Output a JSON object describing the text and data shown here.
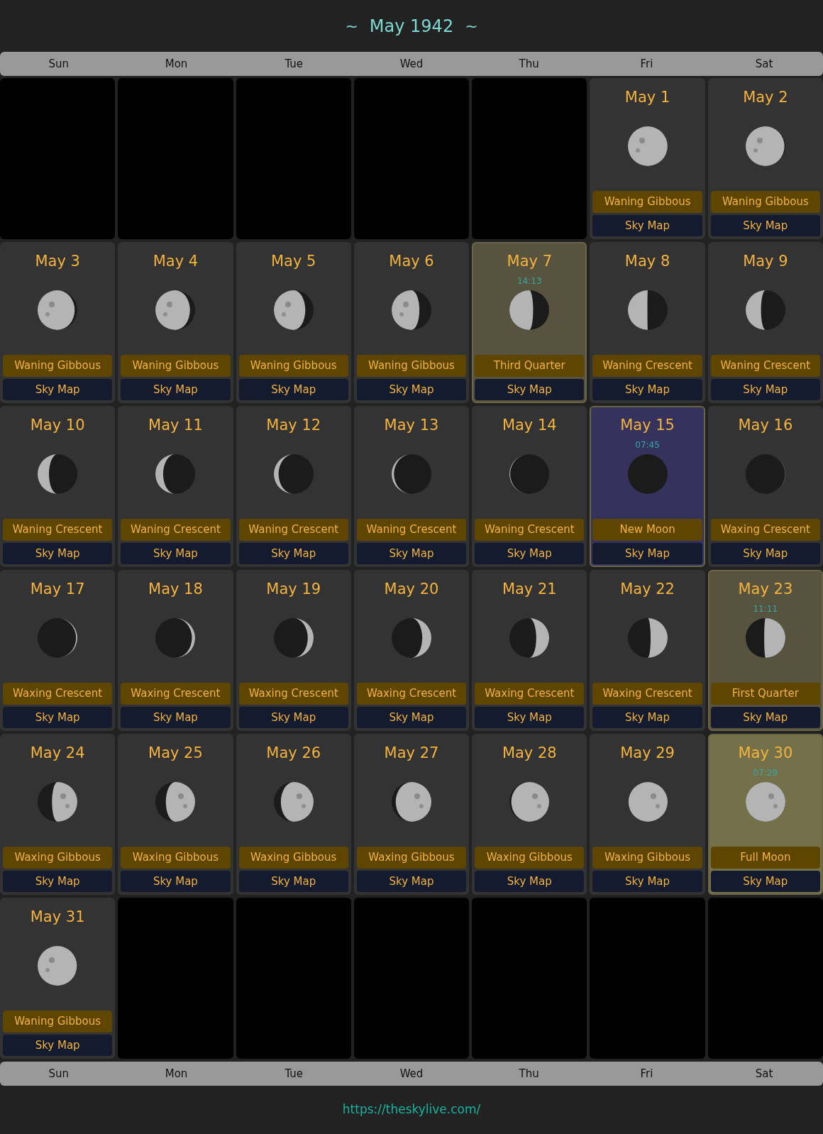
{
  "title": {
    "left": "~",
    "text": "May 1942",
    "right": "~"
  },
  "weekdays_top": [
    "Sun",
    "Mon",
    "Tue",
    "Wed",
    "Thu",
    "Fri",
    "Sat"
  ],
  "cells": [
    {
      "kind": "empty"
    },
    {
      "kind": "empty"
    },
    {
      "kind": "empty"
    },
    {
      "kind": "empty"
    },
    {
      "kind": "empty"
    },
    {
      "kind": "day",
      "date": "May 1",
      "phase": "Waning Gibbous",
      "button": "Sky Map",
      "highlighted": false
    },
    {
      "kind": "day",
      "date": "May 2",
      "phase": "Waning Gibbous",
      "button": "Sky Map",
      "highlighted": false
    },
    {
      "kind": "day",
      "date": "May 3",
      "phase": "Waning Gibbous",
      "button": "Sky Map",
      "highlighted": false
    },
    {
      "kind": "day",
      "date": "May 4",
      "phase": "Waning Gibbous",
      "button": "Sky Map",
      "highlighted": false
    },
    {
      "kind": "day",
      "date": "May 5",
      "phase": "Waning Gibbous",
      "button": "Sky Map",
      "highlighted": false
    },
    {
      "kind": "day",
      "date": "May 6",
      "phase": "Waning Gibbous",
      "button": "Sky Map",
      "highlighted": false
    },
    {
      "kind": "day",
      "date": "May 7",
      "time": "14:13",
      "phase": "Third Quarter",
      "button": "Sky Map",
      "highlighted": true,
      "color": "#58533f"
    },
    {
      "kind": "day",
      "date": "May 8",
      "phase": "Waning Crescent",
      "button": "Sky Map",
      "highlighted": false
    },
    {
      "kind": "day",
      "date": "May 9",
      "phase": "Waning Crescent",
      "button": "Sky Map",
      "highlighted": false
    },
    {
      "kind": "day",
      "date": "May 10",
      "phase": "Waning Crescent",
      "button": "Sky Map",
      "highlighted": false
    },
    {
      "kind": "day",
      "date": "May 11",
      "phase": "Waning Crescent",
      "button": "Sky Map",
      "highlighted": false
    },
    {
      "kind": "day",
      "date": "May 12",
      "phase": "Waning Crescent",
      "button": "Sky Map",
      "highlighted": false
    },
    {
      "kind": "day",
      "date": "May 13",
      "phase": "Waning Crescent",
      "button": "Sky Map",
      "highlighted": false
    },
    {
      "kind": "day",
      "date": "May 14",
      "phase": "Waning Crescent",
      "button": "Sky Map",
      "highlighted": false
    },
    {
      "kind": "day",
      "date": "May 15",
      "time": "07:45",
      "phase": "New Moon",
      "button": "Sky Map",
      "highlighted": true,
      "color": "#35335d"
    },
    {
      "kind": "day",
      "date": "May 16",
      "phase": "Waxing Crescent",
      "button": "Sky Map",
      "highlighted": false
    },
    {
      "kind": "day",
      "date": "May 17",
      "phase": "Waxing Crescent",
      "button": "Sky Map",
      "highlighted": false
    },
    {
      "kind": "day",
      "date": "May 18",
      "phase": "Waxing Crescent",
      "button": "Sky Map",
      "highlighted": false
    },
    {
      "kind": "day",
      "date": "May 19",
      "phase": "Waxing Crescent",
      "button": "Sky Map",
      "highlighted": false
    },
    {
      "kind": "day",
      "date": "May 20",
      "phase": "Waxing Crescent",
      "button": "Sky Map",
      "highlighted": false
    },
    {
      "kind": "day",
      "date": "May 21",
      "phase": "Waxing Crescent",
      "button": "Sky Map",
      "highlighted": false
    },
    {
      "kind": "day",
      "date": "May 22",
      "phase": "Waxing Crescent",
      "button": "Sky Map",
      "highlighted": false
    },
    {
      "kind": "day",
      "date": "May 23",
      "time": "11:11",
      "phase": "First Quarter",
      "button": "Sky Map",
      "highlighted": true,
      "color": "#58533f"
    },
    {
      "kind": "day",
      "date": "May 24",
      "phase": "Waxing Gibbous",
      "button": "Sky Map",
      "highlighted": false
    },
    {
      "kind": "day",
      "date": "May 25",
      "phase": "Waxing Gibbous",
      "button": "Sky Map",
      "highlighted": false
    },
    {
      "kind": "day",
      "date": "May 26",
      "phase": "Waxing Gibbous",
      "button": "Sky Map",
      "highlighted": false
    },
    {
      "kind": "day",
      "date": "May 27",
      "phase": "Waxing Gibbous",
      "button": "Sky Map",
      "highlighted": false
    },
    {
      "kind": "day",
      "date": "May 28",
      "phase": "Waxing Gibbous",
      "button": "Sky Map",
      "highlighted": false
    },
    {
      "kind": "day",
      "date": "May 29",
      "phase": "Waxing Gibbous",
      "button": "Sky Map",
      "highlighted": false
    },
    {
      "kind": "day",
      "date": "May 30",
      "time": "07:29",
      "phase": "Full Moon",
      "button": "Sky Map",
      "highlighted": true,
      "color": "#74704a"
    },
    {
      "kind": "day",
      "date": "May 31",
      "phase": "Waning Gibbous",
      "button": "Sky Map",
      "highlighted": false
    },
    {
      "kind": "empty"
    },
    {
      "kind": "empty"
    },
    {
      "kind": "empty"
    },
    {
      "kind": "empty"
    },
    {
      "kind": "empty"
    },
    {
      "kind": "empty"
    }
  ],
  "weekdays_bottom": [
    "Sun",
    "Mon",
    "Tue",
    "Wed",
    "Thu",
    "Fri",
    "Sat"
  ],
  "footer": {
    "link": "https://theskylive.com/"
  }
}
